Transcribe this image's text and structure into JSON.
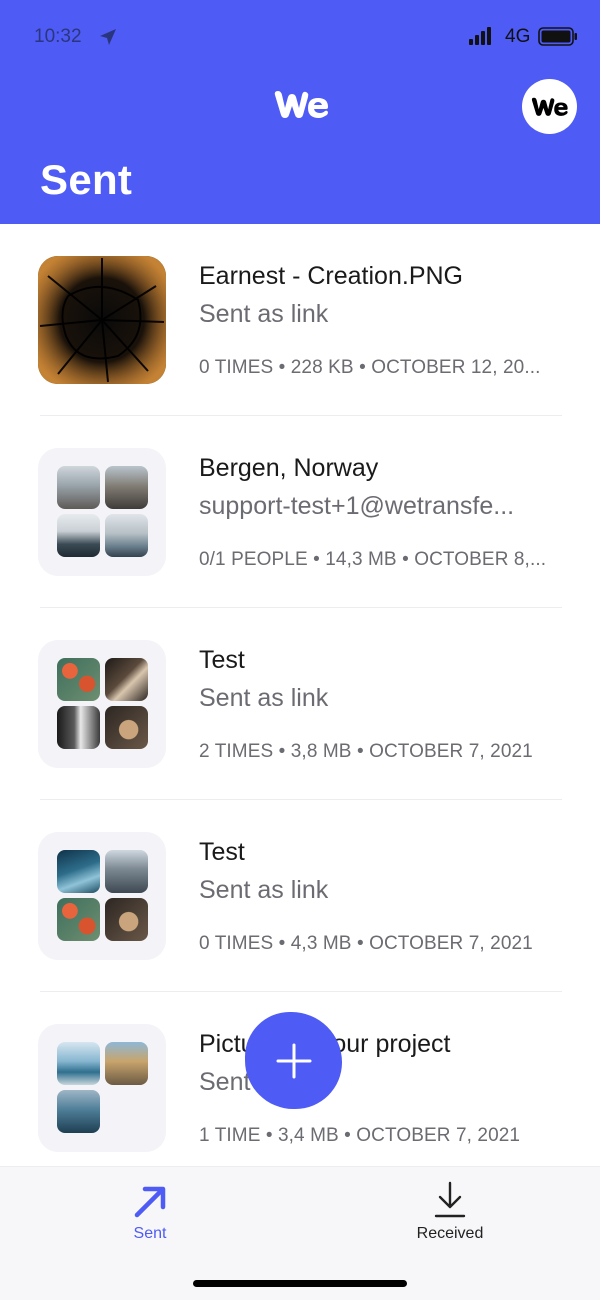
{
  "status_bar": {
    "time": "10:32",
    "network": "4G"
  },
  "header": {
    "title": "Sent"
  },
  "colors": {
    "brand": "#4e5bf5",
    "secondary_text": "#6b6b72"
  },
  "transfers": [
    {
      "title": "Earnest - Creation.PNG",
      "subtitle": "Sent as link",
      "meta": "0 TIMES • 228 KB • OCTOBER 12, 20..."
    },
    {
      "title": "Bergen, Norway",
      "subtitle": "support-test+1@wetransfe...",
      "meta": "0/1 PEOPLE • 14,3 MB • OCTOBER 8,..."
    },
    {
      "title": "Test",
      "subtitle": "Sent as link",
      "meta": "2 TIMES • 3,8 MB • OCTOBER 7, 2021"
    },
    {
      "title": "Test",
      "subtitle": "Sent as link",
      "meta": "0 TIMES • 4,3 MB • OCTOBER 7, 2021"
    },
    {
      "title": "Pictures for our project",
      "subtitle": "Sent as link",
      "meta": "1 TIME • 3,4 MB • OCTOBER 7, 2021"
    }
  ],
  "tabbar": {
    "sent_label": "Sent",
    "received_label": "Received"
  },
  "icons": {
    "location": "location-arrow-icon",
    "signal": "cellular-signal-icon",
    "battery": "battery-icon",
    "logo": "wetransfer-logo",
    "add": "plus-icon",
    "sent": "arrow-up-right-icon",
    "received": "download-icon"
  }
}
